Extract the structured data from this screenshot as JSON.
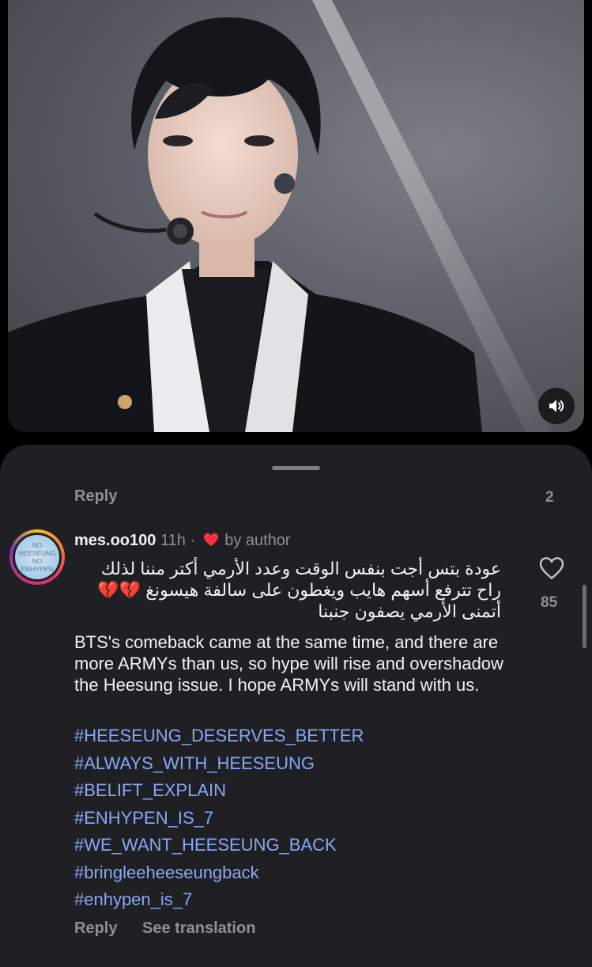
{
  "video": {
    "sound_icon": "speaker-icon"
  },
  "sheet": {
    "reply_label": "Reply",
    "reply_count": "2"
  },
  "comment": {
    "avatar_text": [
      "NO",
      "HEESEUNG",
      "NO",
      "ENHYPEN"
    ],
    "username": "mes.oo100",
    "time": "11h",
    "separator": "·",
    "liked_by": "by author",
    "arabic_lines": [
      "عودة بتس أجت بنفس الوقت وعدد الأرمي أكتر مننا لذلك",
      "راح تترفع أسهم هايب ويغطون على سالفة هيسونغ 💔💔",
      "أتمنى الأرمي يصفون جنبنا"
    ],
    "english_text": "BTS's comeback came at the same time, and there are more ARMYs than us, so hype will rise and overshadow the Heesung issue. I hope ARMYs will stand with us.",
    "hashtags": [
      "#HEESEUNG_DESERVES_BETTER",
      "#ALWAYS_WITH_HEESEUNG",
      "#BELIFT_EXPLAIN",
      "#ENHYPEN_IS_7",
      "#WE_WANT_HEESEUNG_BACK",
      "#bringleeheeseungback",
      "#enhypen_is_7"
    ],
    "like_count": "85",
    "reply_label": "Reply",
    "translation_label": "See translation"
  },
  "colors": {
    "sheet_bg": "#1f2024",
    "hashtag": "#8aa6f5",
    "muted": "#8e9096",
    "author_heart": "#ff3040"
  }
}
